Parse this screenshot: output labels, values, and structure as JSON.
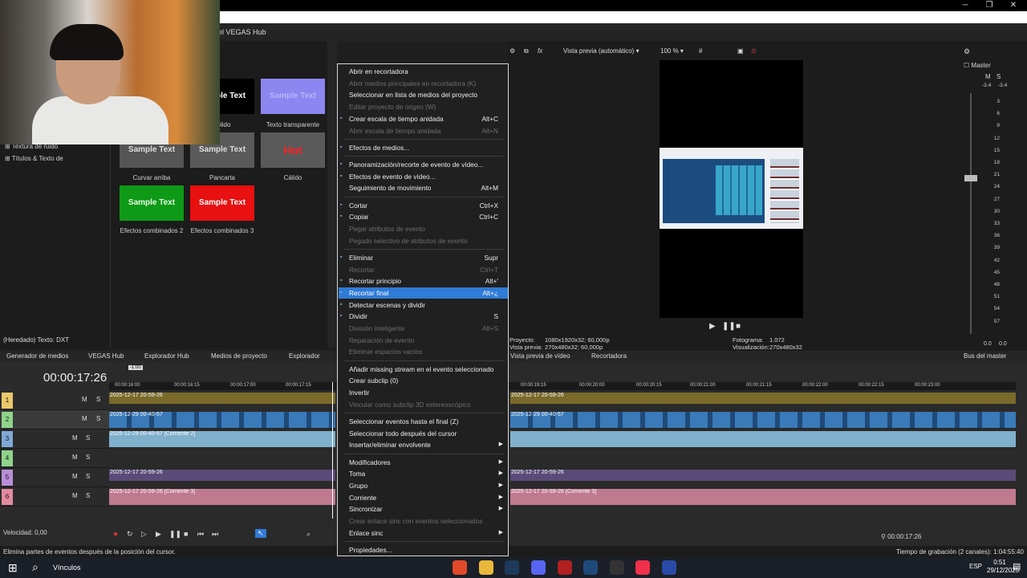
{
  "window": {
    "title": "el VEGAS Hub",
    "minimize": "─",
    "maximize": "❐",
    "close": "✕"
  },
  "media_generator": {
    "tree": [
      "Textura de ruido",
      "Títulos & Texto de"
    ],
    "footer_text": "(Heredado) Texto: DXT",
    "presets": [
      {
        "label": "sólido",
        "thumb_text": "Sample Text"
      },
      {
        "label": "Texto transparente",
        "thumb_text": "Sample Text"
      },
      {
        "label": "Curvar arriba",
        "thumb_text": "Sample Text"
      },
      {
        "label": "Pancarta",
        "thumb_text": "Sample Text"
      },
      {
        "label": "Cálido",
        "thumb_text": "Hot"
      },
      {
        "label": "Efectos combinados 2",
        "thumb_text": "Sample Text"
      },
      {
        "label": "Efectos combinados 3",
        "thumb_text": "Sample Text"
      }
    ]
  },
  "tabs": [
    "Generador de medios",
    "VEGAS Hub",
    "Explorador Hub",
    "Medios de proyecto",
    "Explorador",
    "Vista previa de vídeo",
    "Recortadora",
    "Bus del master"
  ],
  "preview": {
    "mode": "Vista previa (automático)",
    "zoom": "100 %",
    "project_label": "Proyecto:",
    "project_value": "1080x1920x32; 60,000p",
    "preview_label": "Vista previa:",
    "preview_value": "270x480x32; 60,000p",
    "frame_label": "Fotograma:",
    "frame_value": "1.072",
    "display_label": "Visualización:",
    "display_value": "270x480x32"
  },
  "master": {
    "title": "Master",
    "m": "M",
    "s": "S",
    "peak_left": "-3.4",
    "peak_right": "-3.4",
    "ticks": [
      "3",
      "6",
      "9",
      "12",
      "15",
      "18",
      "21",
      "24",
      "27",
      "30",
      "33",
      "36",
      "39",
      "42",
      "45",
      "48",
      "51",
      "54",
      "57"
    ],
    "bottom_left": "0.0",
    "bottom_right": "0.0"
  },
  "timeline": {
    "timecode": "00:00:17:26",
    "marker": "-1:00",
    "ruler": [
      "00:00:16:00",
      "00:00:16:15",
      "00:00:17:00",
      "00:00:17:15",
      "00:00:19:15",
      "00:00:20:00",
      "00:00:20:15",
      "00:00:21:00",
      "00:00:21:15",
      "00:00:22:00",
      "00:00:22:15",
      "00:00:23:00"
    ],
    "tracks": [
      {
        "num": "1",
        "color": "#e8c86a"
      },
      {
        "num": "2",
        "color": "#8fd48a"
      },
      {
        "num": "3",
        "color": "#7fa8d8"
      },
      {
        "num": "4",
        "color": "#8fd48a"
      },
      {
        "num": "5",
        "color": "#b88fd8"
      },
      {
        "num": "6",
        "color": "#e08aa0"
      }
    ],
    "m_label": "M",
    "s_label": "S",
    "clip_labels": [
      "2025-12-17 20-59-26",
      "2025-12-29 00-40-57",
      "2025-12-29 00-40-57 [Corriente 2]",
      "2025-12-17 20-59-26",
      "2025-12-17 20-59-26 [Corriente 3]"
    ],
    "speed": "Velocidad: 0,00",
    "cursor_time": "00:00:17:26",
    "fx": "fx"
  },
  "status": {
    "message": "Elimina partes de eventos después de la posición del cursor.",
    "record_time": "Tiempo de grabación (2 canales): 1:04:55:40"
  },
  "taskbar": {
    "search": "Vínculos",
    "lang": "ESP",
    "time": "0:51",
    "date": "29/12/2025"
  },
  "context_menu": [
    {
      "label": "Abrir en recortadora",
      "shortcut": "",
      "enabled": true
    },
    {
      "label": "Abrir medios principales en recortadora (K)",
      "shortcut": "",
      "enabled": false
    },
    {
      "label": "Seleccionar en lista de medios del proyecto",
      "shortcut": "",
      "enabled": true
    },
    {
      "label": "Editar proyecto de origen (W)",
      "shortcut": "",
      "enabled": false
    },
    {
      "label": "Crear escala de tiempo anidada",
      "shortcut": "Alt+C",
      "enabled": true,
      "icon": "nest-icon"
    },
    {
      "label": "Abrir escala de tiempo anidada",
      "shortcut": "Alt+N",
      "enabled": false
    },
    {
      "sep": true
    },
    {
      "label": "Efectos de medios...",
      "shortcut": "",
      "enabled": true,
      "icon": "fx-icon"
    },
    {
      "sep": true
    },
    {
      "label": "Panoramización/recorte de evento de vídeo...",
      "shortcut": "",
      "enabled": true,
      "icon": "crop-icon"
    },
    {
      "label": "Efectos de evento de vídeo...",
      "shortcut": "",
      "enabled": true,
      "icon": "fx-icon"
    },
    {
      "label": "Seguimiento de movimiento",
      "shortcut": "Alt+M",
      "enabled": true
    },
    {
      "sep": true
    },
    {
      "label": "Cortar",
      "shortcut": "Ctrl+X",
      "enabled": true,
      "icon": "scissors-icon"
    },
    {
      "label": "Copiar",
      "shortcut": "Ctrl+C",
      "enabled": true,
      "icon": "copy-icon"
    },
    {
      "label": "Pegar atributos de evento",
      "shortcut": "",
      "enabled": false
    },
    {
      "label": "Pegado selectivo de atributos de evento",
      "shortcut": "",
      "enabled": false
    },
    {
      "sep": true
    },
    {
      "label": "Eliminar",
      "shortcut": "Supr",
      "enabled": true,
      "icon": "delete-icon"
    },
    {
      "label": "Recortar",
      "shortcut": "Ctrl+T",
      "enabled": false
    },
    {
      "label": "Recortar principio",
      "shortcut": "Alt+'",
      "enabled": true,
      "icon": "trim-start-icon"
    },
    {
      "label": "Recortar final",
      "shortcut": "Alt+¿",
      "enabled": true,
      "highlighted": true,
      "icon": "trim-end-icon"
    },
    {
      "label": "Detectar escenas y dividir",
      "shortcut": "",
      "enabled": true,
      "icon": "scene-icon"
    },
    {
      "label": "Dividir",
      "shortcut": "S",
      "enabled": true,
      "icon": "split-icon"
    },
    {
      "label": "División inteligente",
      "shortcut": "Alt+S",
      "enabled": false
    },
    {
      "label": "Reparación de evento",
      "shortcut": "",
      "enabled": false
    },
    {
      "label": "Eliminar espacios vacíos",
      "shortcut": "",
      "enabled": false
    },
    {
      "sep": true
    },
    {
      "label": "Añadir missing stream en el evento seleccionado",
      "shortcut": "",
      "enabled": true
    },
    {
      "label": "Crear subclip (0)",
      "shortcut": "",
      "enabled": true
    },
    {
      "label": "Invertir",
      "shortcut": "",
      "enabled": true
    },
    {
      "label": "Vincular como subclip 3D estereoscópico",
      "shortcut": "",
      "enabled": false
    },
    {
      "sep": true
    },
    {
      "label": "Seleccionar eventos hasta el final (Z)",
      "shortcut": "",
      "enabled": true
    },
    {
      "label": "Seleccionar todo después del cursor",
      "shortcut": "",
      "enabled": true
    },
    {
      "label": "Insertar/eliminar envolvente",
      "shortcut": "",
      "enabled": true,
      "submenu": true
    },
    {
      "sep": true
    },
    {
      "label": "Modificadores",
      "shortcut": "",
      "enabled": true,
      "submenu": true
    },
    {
      "label": "Toma",
      "shortcut": "",
      "enabled": true,
      "submenu": true
    },
    {
      "label": "Grupo",
      "shortcut": "",
      "enabled": true,
      "submenu": true
    },
    {
      "label": "Corriente",
      "shortcut": "",
      "enabled": true,
      "submenu": true
    },
    {
      "label": "Sincronizar",
      "shortcut": "",
      "enabled": true,
      "submenu": true
    },
    {
      "label": "Crear enlace sinc con eventos seleccionados",
      "shortcut": "",
      "enabled": false
    },
    {
      "label": "Enlace sinc",
      "shortcut": "",
      "enabled": true,
      "submenu": true
    },
    {
      "sep": true
    },
    {
      "label": "Propiedades...",
      "shortcut": "",
      "enabled": true
    }
  ]
}
